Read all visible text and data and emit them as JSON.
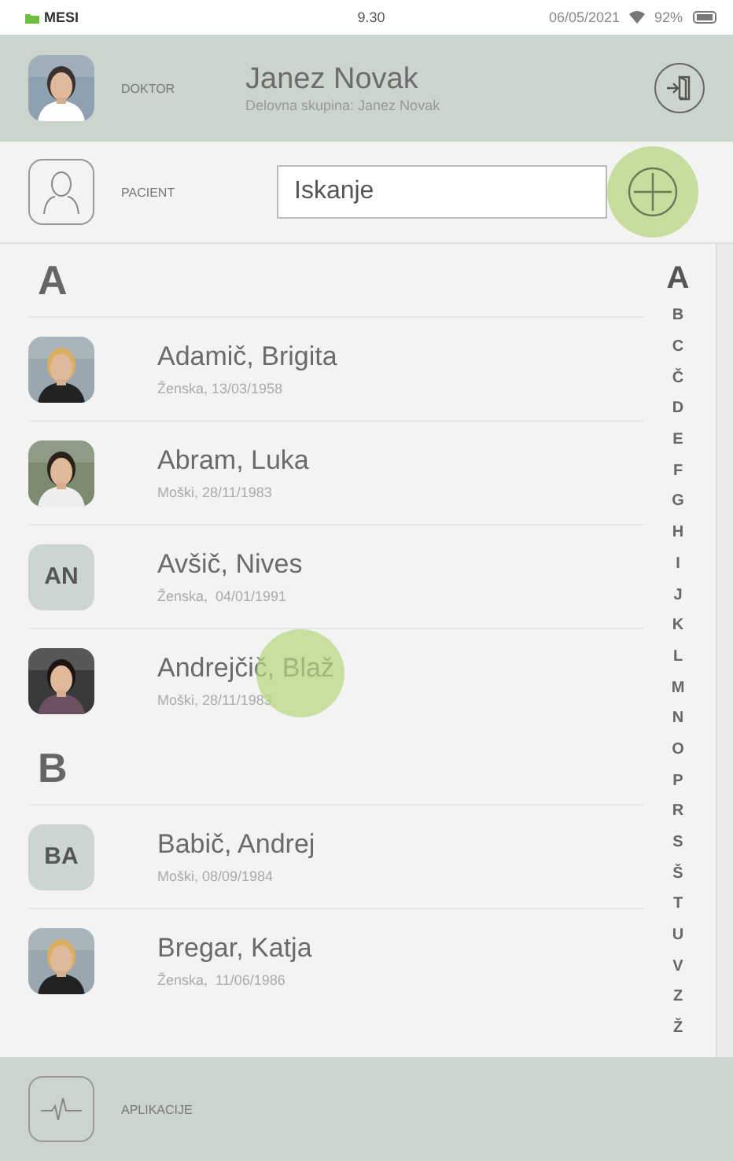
{
  "status_bar": {
    "carrier": "MESI",
    "time": "9.30",
    "date": "06/05/2021",
    "battery": "92%"
  },
  "doctor": {
    "role": "DOKTOR",
    "name": "Janez Novak",
    "group": "Delovna skupina: Janez Novak"
  },
  "patient": {
    "label": "PACIENT",
    "search": {
      "placeholder": "Iskanje"
    }
  },
  "sections": [
    {
      "letter": "A",
      "patients": [
        {
          "name": "Adamič, Brigita",
          "details": "Ženska, 13/03/1958"
        },
        {
          "name": "Abram, Luka",
          "details": "Moški, 28/11/1983"
        },
        {
          "name": "Avšič, Nives",
          "details": "Ženska,  04/01/1991",
          "avatar": {
            "kind": "initials",
            "initials": "AN"
          }
        },
        {
          "name": "Andrejčič, Blaž",
          "details": "Moški, 28/11/1983",
          "touched": true
        }
      ]
    },
    {
      "letter": "B",
      "patients": [
        {
          "name": "Babič, Andrej",
          "details": "Moški, 08/09/1984",
          "avatar": {
            "kind": "initials",
            "initials": "BA"
          }
        },
        {
          "name": "Bregar, Katja",
          "details": "Ženska,  11/06/1986"
        }
      ]
    }
  ],
  "index": [
    {
      "letter": "A",
      "selected": true
    },
    {
      "letter": "B",
      "selected": false
    },
    {
      "letter": "C",
      "selected": false
    },
    {
      "letter": "Č",
      "selected": false
    },
    {
      "letter": "D",
      "selected": false
    },
    {
      "letter": "E",
      "selected": false
    },
    {
      "letter": "F",
      "selected": false
    },
    {
      "letter": "G",
      "selected": false
    },
    {
      "letter": "H",
      "selected": false
    },
    {
      "letter": "I",
      "selected": false
    },
    {
      "letter": "J",
      "selected": false
    },
    {
      "letter": "K",
      "selected": false
    },
    {
      "letter": "L",
      "selected": false
    },
    {
      "letter": "M",
      "selected": false
    },
    {
      "letter": "N",
      "selected": false
    },
    {
      "letter": "O",
      "selected": false
    },
    {
      "letter": "P",
      "selected": false
    },
    {
      "letter": "R",
      "selected": false
    },
    {
      "letter": "S",
      "selected": false
    },
    {
      "letter": "Š",
      "selected": false
    },
    {
      "letter": "T",
      "selected": false
    },
    {
      "letter": "U",
      "selected": false
    },
    {
      "letter": "V",
      "selected": false
    },
    {
      "letter": "Z",
      "selected": false
    },
    {
      "letter": "Ž",
      "selected": false
    }
  ],
  "footer": {
    "label": "APLIKACIJE"
  }
}
